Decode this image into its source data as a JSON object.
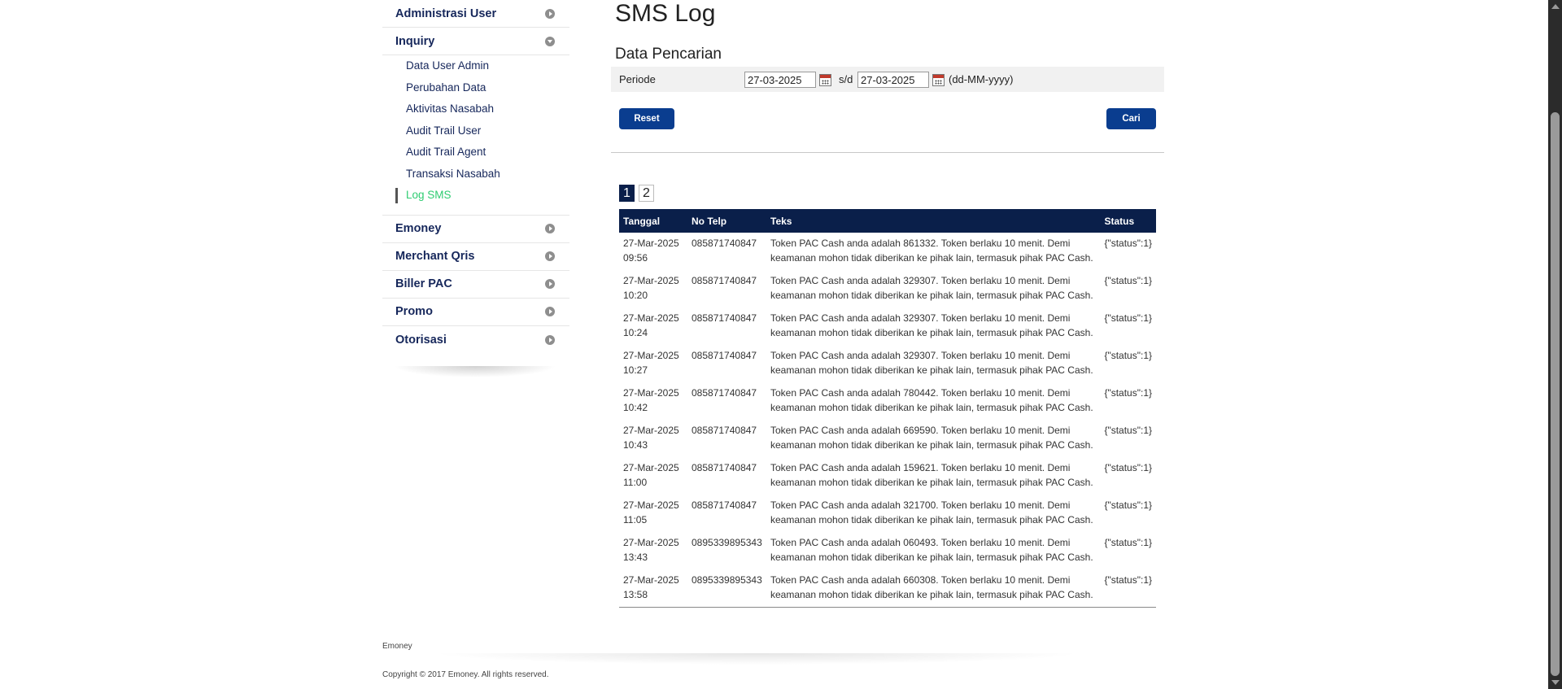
{
  "sidebar": {
    "groups": [
      {
        "label": "Administrasi User",
        "icon": "circle-arrow-right-icon"
      },
      {
        "label": "Inquiry",
        "icon": "circle-arrow-down-icon"
      },
      {
        "label": "Emoney",
        "icon": "circle-arrow-right-icon"
      },
      {
        "label": "Merchant Qris",
        "icon": "circle-arrow-right-icon"
      },
      {
        "label": "Biller PAC",
        "icon": "circle-arrow-right-icon"
      },
      {
        "label": "Promo",
        "icon": "circle-arrow-right-icon"
      },
      {
        "label": "Otorisasi",
        "icon": "circle-arrow-right-icon"
      }
    ],
    "inquiry_items": [
      "Data User Admin",
      "Perubahan Data",
      "Aktivitas Nasabah",
      "Audit Trail User",
      "Audit Trail Agent",
      "Transaksi Nasabah",
      "Log SMS"
    ],
    "active_item": "Log SMS"
  },
  "main": {
    "title": "SMS Log",
    "section_title": "Data Pencarian",
    "filter": {
      "label": "Periode",
      "from": "27-03-2025",
      "separator": "s/d",
      "to": "27-03-2025",
      "format_hint": "(dd-MM-yyyy)"
    },
    "buttons": {
      "reset": "Reset",
      "search": "Cari"
    },
    "pagination": {
      "pages": [
        "1",
        "2"
      ],
      "current": "1"
    },
    "table": {
      "headers": [
        "Tanggal",
        "No Telp",
        "Teks",
        "Status"
      ],
      "rows": [
        {
          "date": "27-Mar-2025",
          "time": "09:56",
          "phone": "085871740847",
          "text1": "Token PAC Cash anda adalah 861332. Token berlaku 10 menit. Demi",
          "text2": "keamanan mohon tidak diberikan ke pihak lain, termasuk pihak PAC Cash.",
          "status": "{\"status\":1}"
        },
        {
          "date": "27-Mar-2025",
          "time": "10:20",
          "phone": "085871740847",
          "text1": "Token PAC Cash anda adalah 329307. Token berlaku 10 menit. Demi",
          "text2": "keamanan mohon tidak diberikan ke pihak lain, termasuk pihak PAC Cash.",
          "status": "{\"status\":1}"
        },
        {
          "date": "27-Mar-2025",
          "time": "10:24",
          "phone": "085871740847",
          "text1": "Token PAC Cash anda adalah 329307. Token berlaku 10 menit. Demi",
          "text2": "keamanan mohon tidak diberikan ke pihak lain, termasuk pihak PAC Cash.",
          "status": "{\"status\":1}"
        },
        {
          "date": "27-Mar-2025",
          "time": "10:27",
          "phone": "085871740847",
          "text1": "Token PAC Cash anda adalah 329307. Token berlaku 10 menit. Demi",
          "text2": "keamanan mohon tidak diberikan ke pihak lain, termasuk pihak PAC Cash.",
          "status": "{\"status\":1}"
        },
        {
          "date": "27-Mar-2025",
          "time": "10:42",
          "phone": "085871740847",
          "text1": "Token PAC Cash anda adalah 780442. Token berlaku 10 menit. Demi",
          "text2": "keamanan mohon tidak diberikan ke pihak lain, termasuk pihak PAC Cash.",
          "status": "{\"status\":1}"
        },
        {
          "date": "27-Mar-2025",
          "time": "10:43",
          "phone": "085871740847",
          "text1": "Token PAC Cash anda adalah 669590. Token berlaku 10 menit. Demi",
          "text2": "keamanan mohon tidak diberikan ke pihak lain, termasuk pihak PAC Cash.",
          "status": "{\"status\":1}"
        },
        {
          "date": "27-Mar-2025",
          "time": "11:00",
          "phone": "085871740847",
          "text1": "Token PAC Cash anda adalah 159621. Token berlaku 10 menit. Demi",
          "text2": "keamanan mohon tidak diberikan ke pihak lain, termasuk pihak PAC Cash.",
          "status": "{\"status\":1}"
        },
        {
          "date": "27-Mar-2025",
          "time": "11:05",
          "phone": "085871740847",
          "text1": "Token PAC Cash anda adalah 321700. Token berlaku 10 menit. Demi",
          "text2": "keamanan mohon tidak diberikan ke pihak lain, termasuk pihak PAC Cash.",
          "status": "{\"status\":1}"
        },
        {
          "date": "27-Mar-2025",
          "time": "13:43",
          "phone": "0895339895343",
          "text1": "Token PAC Cash anda adalah 060493. Token berlaku 10 menit. Demi",
          "text2": "keamanan mohon tidak diberikan ke pihak lain, termasuk pihak PAC Cash.",
          "status": "{\"status\":1}"
        },
        {
          "date": "27-Mar-2025",
          "time": "13:58",
          "phone": "0895339895343",
          "text1": "Token PAC Cash anda adalah 660308. Token berlaku 10 menit. Demi",
          "text2": "keamanan mohon tidak diberikan ke pihak lain, termasuk pihak PAC Cash.",
          "status": "{\"status\":1}"
        }
      ]
    }
  },
  "footer": {
    "brand": "Emoney",
    "copyright": "Copyright © 2017 Emoney. All rights reserved."
  },
  "colors": {
    "nav_text": "#16275b",
    "active_item": "#2ecc71",
    "button": "#0a3d8f",
    "table_header": "#0a1f4a"
  }
}
